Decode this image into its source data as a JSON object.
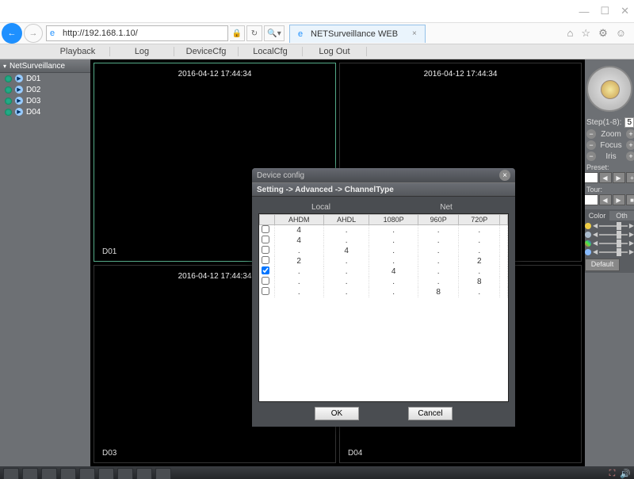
{
  "titlebar": {
    "min": "—",
    "max": "☐",
    "close": "✕"
  },
  "nav": {
    "url": "http://192.168.1.10/",
    "refresh": "↻",
    "searchopt": "▾",
    "tab_title": "NETSurveillance WEB",
    "tab_close": "×",
    "icons": {
      "home": "⌂",
      "star": "☆",
      "gear": "⚙",
      "smile": "☺"
    }
  },
  "menu": {
    "playback": "Playback",
    "log": "Log",
    "devicecfg": "DeviceCfg",
    "localcfg": "LocalCfg",
    "logout": "Log Out"
  },
  "sidebar": {
    "title": "NetSurveillance",
    "channels": [
      {
        "label": "D01"
      },
      {
        "label": "D02"
      },
      {
        "label": "D03"
      },
      {
        "label": "D04"
      }
    ]
  },
  "cells": [
    {
      "ts": "2016-04-12 17:44:34",
      "label": "D01"
    },
    {
      "ts": "2016-04-12 17:44:34",
      "label": ""
    },
    {
      "ts": "2016-04-12 17:44:34",
      "label": "D03"
    },
    {
      "ts": "",
      "label": "D04"
    }
  ],
  "right": {
    "step": "Step(1-8):",
    "stepv": "5",
    "zoom": "Zoom",
    "focus": "Focus",
    "iris": "Iris",
    "preset": "Preset:",
    "tour": "Tour:",
    "color": "Color",
    "oth": "Oth",
    "default": "Default"
  },
  "modal": {
    "title": "Device config",
    "crumb": "Setting -> Advanced -> ChannelType",
    "local": "Local",
    "net": "Net",
    "cols": [
      "",
      "AHDM",
      "AHDL",
      "1080P",
      "960P",
      "720P",
      ""
    ],
    "rows": [
      {
        "chk": false,
        "v": [
          "4",
          ".",
          ".",
          ".",
          ".",
          ""
        ]
      },
      {
        "chk": false,
        "v": [
          "4",
          ".",
          ".",
          ".",
          ".",
          ""
        ]
      },
      {
        "chk": false,
        "v": [
          ".",
          "4",
          ".",
          ".",
          ".",
          ""
        ]
      },
      {
        "chk": false,
        "v": [
          "2",
          ".",
          ".",
          ".",
          "2",
          ""
        ]
      },
      {
        "chk": true,
        "v": [
          ".",
          ".",
          "4",
          ".",
          ".",
          ""
        ]
      },
      {
        "chk": false,
        "v": [
          ".",
          ".",
          ".",
          ".",
          "8",
          ""
        ]
      },
      {
        "chk": false,
        "v": [
          ".",
          ".",
          ".",
          "8",
          ".",
          ""
        ]
      }
    ],
    "ok": "OK",
    "cancel": "Cancel"
  }
}
